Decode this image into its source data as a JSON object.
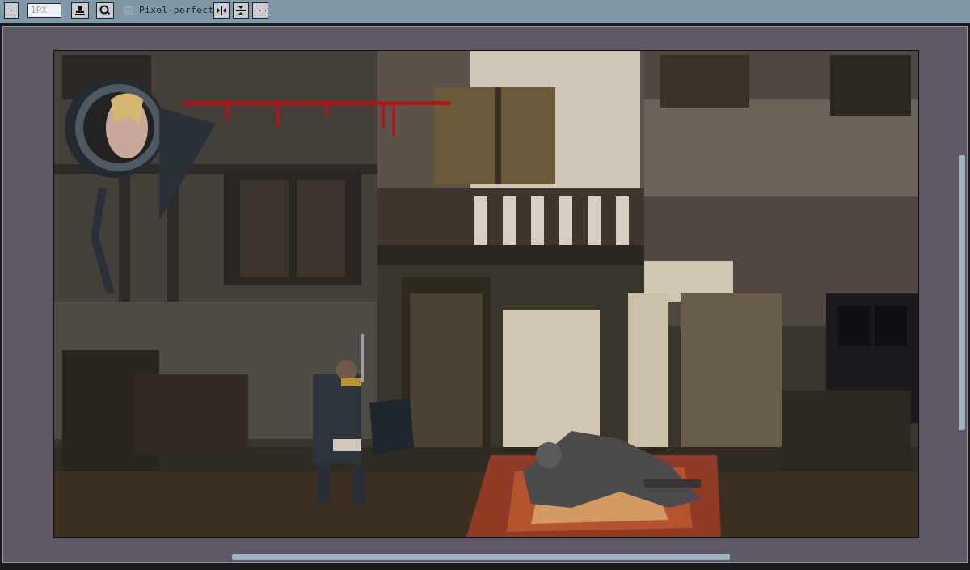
{
  "toolbar": {
    "menu_button_label": "·",
    "brush_size_value": "1PX",
    "pixel_perfect_label": "Pixel-perfect",
    "more_button_label": "···"
  },
  "canvas_art": {
    "game_scene": "medieval town street, armored knight with shield facing crouching ghoul on bloodied floor",
    "hud": "character portrait with red health bar"
  },
  "colors": {
    "toolbar_bg": "#7f99a9",
    "panel_bg": "#5f5763",
    "scroll_thumb": "#9cb3c2",
    "health_bar": "#b0151a"
  }
}
